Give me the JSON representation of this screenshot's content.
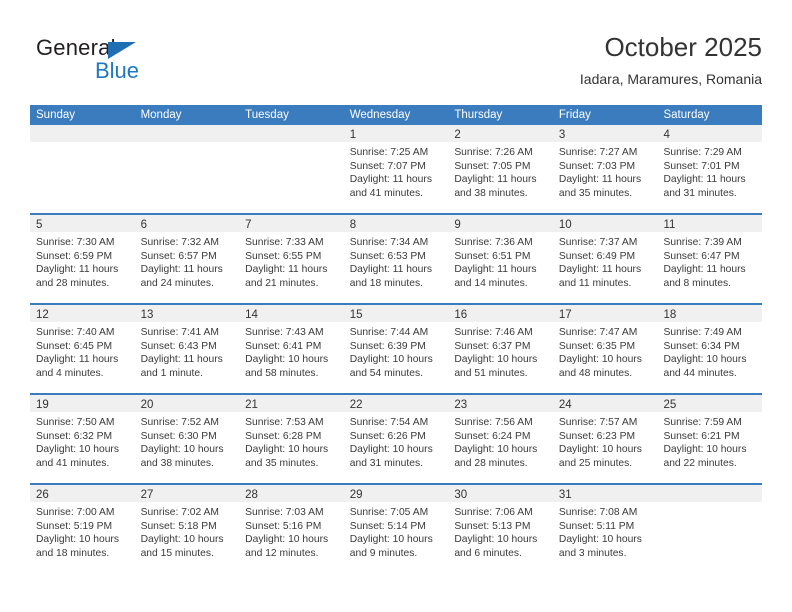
{
  "brand": {
    "name_top": "General",
    "name_bottom": "Blue",
    "triangle_color": "#1f6fb2",
    "blue_color": "#1f78c1"
  },
  "header": {
    "title": "October 2025",
    "subtitle": "Iadara, Maramures, Romania"
  },
  "theme": {
    "header_blue": "#3a7cbe",
    "daynum_band": "#f0f0f0",
    "text": "#333333"
  },
  "weekdays": [
    "Sunday",
    "Monday",
    "Tuesday",
    "Wednesday",
    "Thursday",
    "Friday",
    "Saturday"
  ],
  "labels": {
    "sunrise_prefix": "Sunrise:",
    "sunset_prefix": "Sunset:",
    "daylight_prefix": "Daylight:"
  },
  "weeks": [
    [
      {
        "day": "",
        "empty": true
      },
      {
        "day": "",
        "empty": true
      },
      {
        "day": "",
        "empty": true
      },
      {
        "day": "1",
        "sunrise": "Sunrise: 7:25 AM",
        "sunset": "Sunset: 7:07 PM",
        "daylight_1": "Daylight: 11 hours",
        "daylight_2": "and 41 minutes."
      },
      {
        "day": "2",
        "sunrise": "Sunrise: 7:26 AM",
        "sunset": "Sunset: 7:05 PM",
        "daylight_1": "Daylight: 11 hours",
        "daylight_2": "and 38 minutes."
      },
      {
        "day": "3",
        "sunrise": "Sunrise: 7:27 AM",
        "sunset": "Sunset: 7:03 PM",
        "daylight_1": "Daylight: 11 hours",
        "daylight_2": "and 35 minutes."
      },
      {
        "day": "4",
        "sunrise": "Sunrise: 7:29 AM",
        "sunset": "Sunset: 7:01 PM",
        "daylight_1": "Daylight: 11 hours",
        "daylight_2": "and 31 minutes."
      }
    ],
    [
      {
        "day": "5",
        "sunrise": "Sunrise: 7:30 AM",
        "sunset": "Sunset: 6:59 PM",
        "daylight_1": "Daylight: 11 hours",
        "daylight_2": "and 28 minutes."
      },
      {
        "day": "6",
        "sunrise": "Sunrise: 7:32 AM",
        "sunset": "Sunset: 6:57 PM",
        "daylight_1": "Daylight: 11 hours",
        "daylight_2": "and 24 minutes."
      },
      {
        "day": "7",
        "sunrise": "Sunrise: 7:33 AM",
        "sunset": "Sunset: 6:55 PM",
        "daylight_1": "Daylight: 11 hours",
        "daylight_2": "and 21 minutes."
      },
      {
        "day": "8",
        "sunrise": "Sunrise: 7:34 AM",
        "sunset": "Sunset: 6:53 PM",
        "daylight_1": "Daylight: 11 hours",
        "daylight_2": "and 18 minutes."
      },
      {
        "day": "9",
        "sunrise": "Sunrise: 7:36 AM",
        "sunset": "Sunset: 6:51 PM",
        "daylight_1": "Daylight: 11 hours",
        "daylight_2": "and 14 minutes."
      },
      {
        "day": "10",
        "sunrise": "Sunrise: 7:37 AM",
        "sunset": "Sunset: 6:49 PM",
        "daylight_1": "Daylight: 11 hours",
        "daylight_2": "and 11 minutes."
      },
      {
        "day": "11",
        "sunrise": "Sunrise: 7:39 AM",
        "sunset": "Sunset: 6:47 PM",
        "daylight_1": "Daylight: 11 hours",
        "daylight_2": "and 8 minutes."
      }
    ],
    [
      {
        "day": "12",
        "sunrise": "Sunrise: 7:40 AM",
        "sunset": "Sunset: 6:45 PM",
        "daylight_1": "Daylight: 11 hours",
        "daylight_2": "and 4 minutes."
      },
      {
        "day": "13",
        "sunrise": "Sunrise: 7:41 AM",
        "sunset": "Sunset: 6:43 PM",
        "daylight_1": "Daylight: 11 hours",
        "daylight_2": "and 1 minute."
      },
      {
        "day": "14",
        "sunrise": "Sunrise: 7:43 AM",
        "sunset": "Sunset: 6:41 PM",
        "daylight_1": "Daylight: 10 hours",
        "daylight_2": "and 58 minutes."
      },
      {
        "day": "15",
        "sunrise": "Sunrise: 7:44 AM",
        "sunset": "Sunset: 6:39 PM",
        "daylight_1": "Daylight: 10 hours",
        "daylight_2": "and 54 minutes."
      },
      {
        "day": "16",
        "sunrise": "Sunrise: 7:46 AM",
        "sunset": "Sunset: 6:37 PM",
        "daylight_1": "Daylight: 10 hours",
        "daylight_2": "and 51 minutes."
      },
      {
        "day": "17",
        "sunrise": "Sunrise: 7:47 AM",
        "sunset": "Sunset: 6:35 PM",
        "daylight_1": "Daylight: 10 hours",
        "daylight_2": "and 48 minutes."
      },
      {
        "day": "18",
        "sunrise": "Sunrise: 7:49 AM",
        "sunset": "Sunset: 6:34 PM",
        "daylight_1": "Daylight: 10 hours",
        "daylight_2": "and 44 minutes."
      }
    ],
    [
      {
        "day": "19",
        "sunrise": "Sunrise: 7:50 AM",
        "sunset": "Sunset: 6:32 PM",
        "daylight_1": "Daylight: 10 hours",
        "daylight_2": "and 41 minutes."
      },
      {
        "day": "20",
        "sunrise": "Sunrise: 7:52 AM",
        "sunset": "Sunset: 6:30 PM",
        "daylight_1": "Daylight: 10 hours",
        "daylight_2": "and 38 minutes."
      },
      {
        "day": "21",
        "sunrise": "Sunrise: 7:53 AM",
        "sunset": "Sunset: 6:28 PM",
        "daylight_1": "Daylight: 10 hours",
        "daylight_2": "and 35 minutes."
      },
      {
        "day": "22",
        "sunrise": "Sunrise: 7:54 AM",
        "sunset": "Sunset: 6:26 PM",
        "daylight_1": "Daylight: 10 hours",
        "daylight_2": "and 31 minutes."
      },
      {
        "day": "23",
        "sunrise": "Sunrise: 7:56 AM",
        "sunset": "Sunset: 6:24 PM",
        "daylight_1": "Daylight: 10 hours",
        "daylight_2": "and 28 minutes."
      },
      {
        "day": "24",
        "sunrise": "Sunrise: 7:57 AM",
        "sunset": "Sunset: 6:23 PM",
        "daylight_1": "Daylight: 10 hours",
        "daylight_2": "and 25 minutes."
      },
      {
        "day": "25",
        "sunrise": "Sunrise: 7:59 AM",
        "sunset": "Sunset: 6:21 PM",
        "daylight_1": "Daylight: 10 hours",
        "daylight_2": "and 22 minutes."
      }
    ],
    [
      {
        "day": "26",
        "sunrise": "Sunrise: 7:00 AM",
        "sunset": "Sunset: 5:19 PM",
        "daylight_1": "Daylight: 10 hours",
        "daylight_2": "and 18 minutes."
      },
      {
        "day": "27",
        "sunrise": "Sunrise: 7:02 AM",
        "sunset": "Sunset: 5:18 PM",
        "daylight_1": "Daylight: 10 hours",
        "daylight_2": "and 15 minutes."
      },
      {
        "day": "28",
        "sunrise": "Sunrise: 7:03 AM",
        "sunset": "Sunset: 5:16 PM",
        "daylight_1": "Daylight: 10 hours",
        "daylight_2": "and 12 minutes."
      },
      {
        "day": "29",
        "sunrise": "Sunrise: 7:05 AM",
        "sunset": "Sunset: 5:14 PM",
        "daylight_1": "Daylight: 10 hours",
        "daylight_2": "and 9 minutes."
      },
      {
        "day": "30",
        "sunrise": "Sunrise: 7:06 AM",
        "sunset": "Sunset: 5:13 PM",
        "daylight_1": "Daylight: 10 hours",
        "daylight_2": "and 6 minutes."
      },
      {
        "day": "31",
        "sunrise": "Sunrise: 7:08 AM",
        "sunset": "Sunset: 5:11 PM",
        "daylight_1": "Daylight: 10 hours",
        "daylight_2": "and 3 minutes."
      },
      {
        "day": "",
        "empty": true
      }
    ]
  ]
}
